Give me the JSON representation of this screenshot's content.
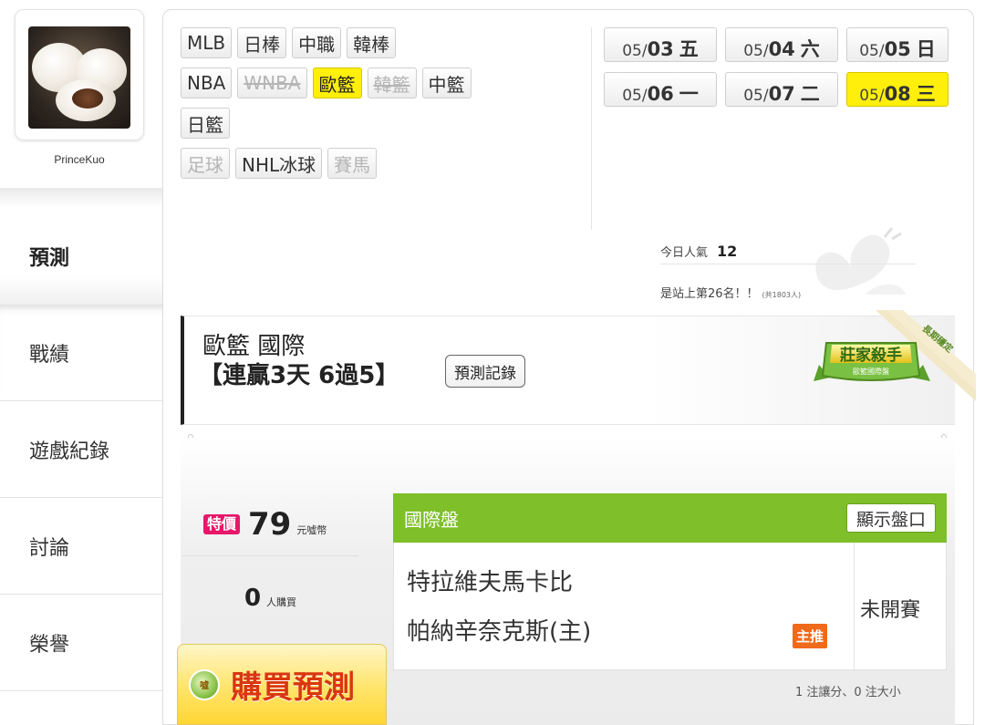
{
  "user": {
    "name": "PrinceKuo"
  },
  "nav": {
    "items": [
      {
        "label": "預測",
        "active": true
      },
      {
        "label": "戰績"
      },
      {
        "label": "遊戲紀錄"
      },
      {
        "label": "討論"
      },
      {
        "label": "榮譽"
      }
    ]
  },
  "leagues": {
    "row1": [
      {
        "label": "MLB"
      },
      {
        "label": "日棒"
      },
      {
        "label": "中職"
      },
      {
        "label": "韓棒"
      }
    ],
    "row2": [
      {
        "label": "NBA"
      },
      {
        "label": "WNBA",
        "state": "disabled"
      },
      {
        "label": "歐籃",
        "state": "selected"
      },
      {
        "label": "韓籃",
        "state": "disabled"
      },
      {
        "label": "中籃"
      }
    ],
    "row3": [
      {
        "label": "日籃"
      }
    ],
    "row4": [
      {
        "label": "足球",
        "state": "disabled"
      },
      {
        "label": "NHL冰球"
      },
      {
        "label": "賽馬",
        "state": "disabled"
      }
    ]
  },
  "dates": [
    {
      "month": "05/",
      "day": "03",
      "weekday": "五"
    },
    {
      "month": "05/",
      "day": "04",
      "weekday": "六"
    },
    {
      "month": "05/",
      "day": "05",
      "weekday": "日"
    },
    {
      "month": "05/",
      "day": "06",
      "weekday": "一"
    },
    {
      "month": "05/",
      "day": "07",
      "weekday": "二"
    },
    {
      "month": "05/",
      "day": "08",
      "weekday": "三",
      "selected": true
    }
  ],
  "popularity": {
    "label": "今日人氣",
    "value": "12",
    "rank_text": "是站上第26名！！",
    "total_text": "(共1803人)"
  },
  "prediction": {
    "title": "歐籃 國際",
    "streak": "【連贏3天 6過5】",
    "record_button": "預測記錄",
    "badge_title": "莊家殺手",
    "badge_sub": "歐籃國際盤",
    "ribbon_text": "長期穩定"
  },
  "price": {
    "tag": "特價",
    "amount": "79",
    "unit": "元噓幣",
    "buyers": "0",
    "buyers_unit": "人購買",
    "buy_button": "購買預測",
    "buy_icon_text": "噓"
  },
  "market": {
    "title": "國際盤",
    "show_odds": "顯示盤口",
    "team_away": "特拉維夫馬卡比",
    "team_home": "帕納辛奈克斯(主)",
    "pick_tag": "主推",
    "status": "未開賽",
    "summary": "1 注讓分、0 注大小"
  },
  "colors": {
    "selected_yellow": "#ffef0a",
    "market_green": "#7ebf2a",
    "special_pink": "#e8176a",
    "pick_orange": "#ef6a1a",
    "buy_red": "#d9370f"
  }
}
